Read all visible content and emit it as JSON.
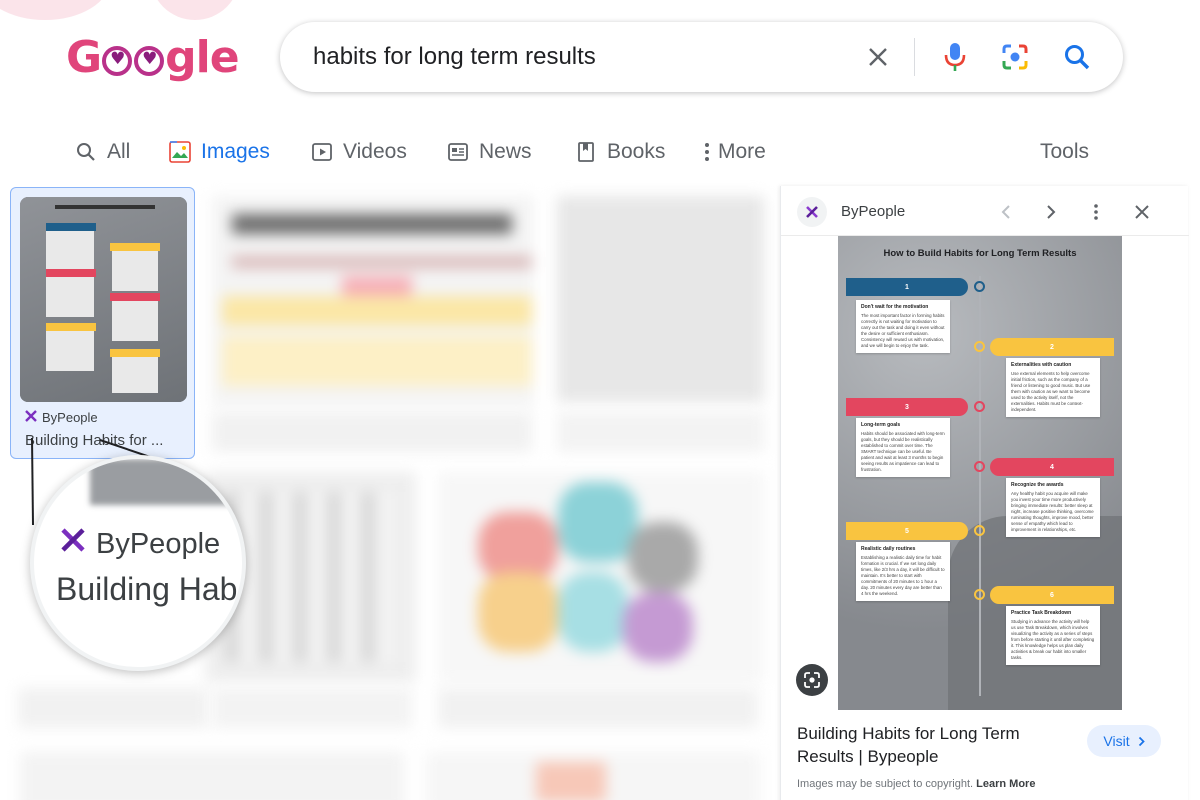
{
  "search": {
    "query": "habits for long term results"
  },
  "logo": {
    "text_g": "G",
    "text_gle": "gle"
  },
  "tabs": {
    "all": "All",
    "images": "Images",
    "videos": "Videos",
    "news": "News",
    "books": "Books",
    "more": "More",
    "tools": "Tools"
  },
  "selected_result": {
    "source": "ByPeople",
    "title": "Building Habits for ..."
  },
  "magnifier": {
    "source": "ByPeople",
    "title": "Building Hab"
  },
  "panel": {
    "site": "ByPeople",
    "title": "Building Habits for Long Term Results | Bypeople",
    "visit": "Visit",
    "copyright": "Images may be subject to copyright.",
    "learn_more": "Learn More"
  },
  "infographic": {
    "title": "How to Build Habits for Long Term Results",
    "steps": [
      {
        "num": "1",
        "heading": "Don't wait for the motivation",
        "body": "The most important factor in forming habits correctly is not waiting for motivation to carry out the task and doing it even without the desire or sufficient enthusiasm. Consistency will reward us with motivation, and we will begin to enjoy the task."
      },
      {
        "num": "2",
        "heading": "Externalities with caution",
        "body": "Use external elements to help overcome initial friction, such as the company of a friend or listening to good music. But use them with caution as we want to become used to the activity itself, not the externalities. Habits must be context-independent."
      },
      {
        "num": "3",
        "heading": "Long-term goals",
        "body": "Habits should be associated with long-term goals, but they should be realistically established to commit over time. The SMART technique can be useful. Be patient and wait at least 3 months to begin seeing results as impatience can lead to frustration."
      },
      {
        "num": "4",
        "heading": "Recognize the awards",
        "body": "Any healthy habit you acquire will make you invest your time more productively bringing immediate results: better sleep at night, increase positive thinking, overcome ruminating thoughts, improve mood, better sense of empathy which lead to improvement in relationships, etc."
      },
      {
        "num": "5",
        "heading": "Realistic daily routines",
        "body": "Establishing a realistic daily time for habit formation is crucial. If we set long daily times, like 2/3 hrs a day, it will be difficult to maintain. It's better to start with commitments of 20 minutes to 1 hour a day. 20 minutes every day are better than 4 hrs the weekend."
      },
      {
        "num": "6",
        "heading": "Practice Task Breakdown",
        "body": "Studying in advance the activity will help us use Task Breakdown, which involves visualizing the activity as a series of steps from before starting it until after completing it. This knowledge helps us plan daily activities & break our habit into smaller tasks."
      }
    ]
  },
  "colors": {
    "blue_ribbon": "#1f5f8b",
    "yellow_ribbon": "#f9c440",
    "red_ribbon": "#e3465f",
    "accent_blue": "#1a73e8",
    "logo_pink": "#e0457b"
  },
  "icons": {
    "clear": "close-icon",
    "mic": "microphone-icon",
    "lens": "camera-lens-icon",
    "search": "search-icon"
  }
}
